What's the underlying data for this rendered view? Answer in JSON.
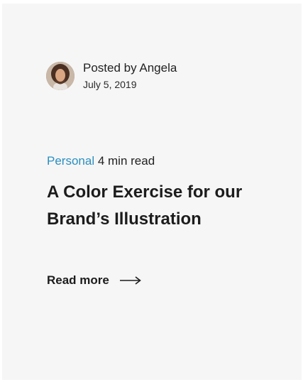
{
  "post": {
    "author_line": "Posted by Angela",
    "date": "July 5, 2019",
    "category": "Personal",
    "read_time": "4 min read",
    "title": "A Color Exercise for our Brand’s Illustration",
    "read_more_label": "Read more",
    "avatar_icon": "author-avatar",
    "arrow_icon": "arrow-right-icon"
  },
  "colors": {
    "category": "#2b8fc0",
    "card_background": "#f6f6f6",
    "text": "#1c1c1c"
  }
}
